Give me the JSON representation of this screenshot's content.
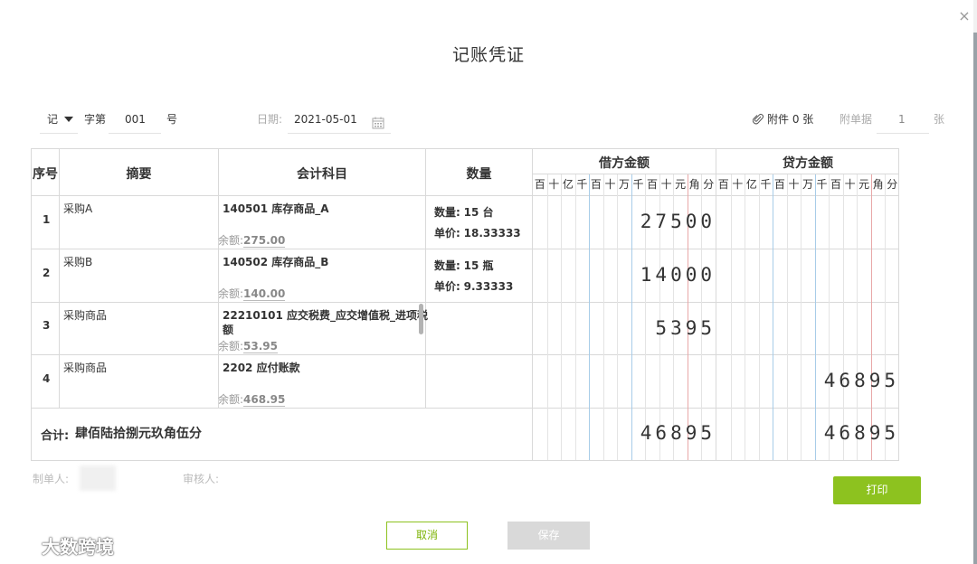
{
  "dialog": {
    "title": "记账凭证",
    "close_symbol": "×"
  },
  "header": {
    "voucher_word": "记",
    "word_label": "字第",
    "voucher_no": "001",
    "no_suffix": "号",
    "date_label": "日期:",
    "date_value": "2021-05-01",
    "attachment_label": "附件 0 张",
    "doc_label": "附单据",
    "doc_count": "1",
    "doc_unit": "张"
  },
  "columns": {
    "seq": "序号",
    "summary": "摘要",
    "account": "会计科目",
    "quantity": "数量",
    "debit": "借方金额",
    "credit": "贷方金额",
    "units": [
      "百",
      "十",
      "亿",
      "千",
      "百",
      "十",
      "万",
      "千",
      "百",
      "十",
      "元",
      "角",
      "分"
    ]
  },
  "rows": [
    {
      "seq": "1",
      "summary": "采购A",
      "account": "140501 库存商品_A",
      "balance_label": "余额:",
      "balance": "275.00",
      "qty_label": "数量:",
      "qty": "15 台",
      "price_label": "单价:",
      "price": "18.33333",
      "debit": "27500",
      "credit": ""
    },
    {
      "seq": "2",
      "summary": "采购B",
      "account": "140502 库存商品_B",
      "balance_label": "余额:",
      "balance": "140.00",
      "qty_label": "数量:",
      "qty": "15 瓶",
      "price_label": "单价:",
      "price": "9.33333",
      "debit": "14000",
      "credit": ""
    },
    {
      "seq": "3",
      "summary": "采购商品",
      "account_line1": "22210101 应交税费_应交增值税_进项税",
      "account_line2": "额",
      "balance_label": "余额:",
      "balance": "53.95",
      "debit": "5395",
      "credit": ""
    },
    {
      "seq": "4",
      "summary": "采购商品",
      "account": "2202 应付账款",
      "balance_label": "余额:",
      "balance": "468.95",
      "debit": "",
      "credit": "46895"
    }
  ],
  "total": {
    "label": "合计:",
    "amount_words": "肆佰陆拾捌元玖角伍分",
    "debit": "46895",
    "credit": "46895"
  },
  "footer": {
    "maker_label": "制单人:",
    "reviewer_label": "审核人:",
    "print_label": "打印",
    "cancel_label": "取消",
    "save_label": "保存"
  },
  "watermark": {
    "text": "大数跨境"
  },
  "colors": {
    "accent_green": "#8dc21f",
    "grid_line": "#d9d9d9",
    "digit_blue_line": "#a8cce8",
    "digit_red_line": "#e8a8a8"
  },
  "icons": [
    "chevron-down-icon",
    "calendar-icon",
    "paperclip-icon",
    "close-icon"
  ]
}
